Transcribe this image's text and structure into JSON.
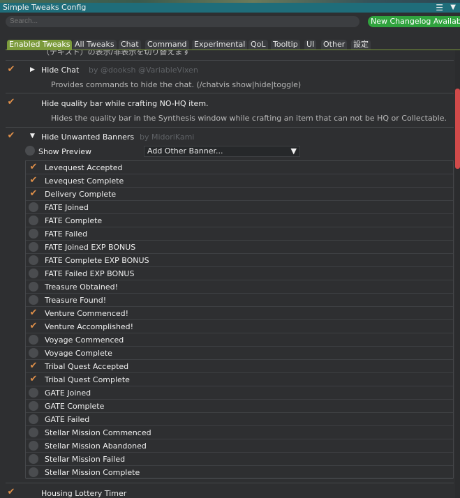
{
  "window": {
    "title": "Simple Tweaks Config",
    "menu_icon": "hamburger-icon",
    "collapse_icon": "triangle-down-icon"
  },
  "search": {
    "placeholder": "Search..."
  },
  "changelog_button": "New Changelog Available",
  "tabs": [
    {
      "label": "Enabled Tweaks",
      "active": true
    },
    {
      "label": "All Tweaks"
    },
    {
      "label": "Chat"
    },
    {
      "label": "Command"
    },
    {
      "label": "Experimental"
    },
    {
      "label": "QoL"
    },
    {
      "label": "Tooltip"
    },
    {
      "label": "UI"
    },
    {
      "label": "Other"
    },
    {
      "label": "設定"
    }
  ],
  "cut_off_text": "（テキスト）の表示/非表示を切り替えます",
  "tweaks": [
    {
      "name": "Hide Chat",
      "author": "by @dooksh @VariableVixen",
      "desc": "Provides commands to hide the chat. (/chatvis show|hide|toggle)",
      "enabled": true
    },
    {
      "name": "Hide quality bar while crafting NO-HQ item.",
      "author": "",
      "desc": "Hides the quality bar in the Synthesis window while crafting an item that can not be HQ or Collectable.",
      "enabled": true
    },
    {
      "name": "Hide Unwanted Banners",
      "author": "by MidoriKami",
      "desc": "",
      "enabled": true
    },
    {
      "name": "Housing Lottery Timer",
      "author": "",
      "desc": "",
      "enabled": true
    }
  ],
  "banners": {
    "show_preview_label": "Show Preview",
    "add_other_label": "Add Other Banner...",
    "items": [
      {
        "label": "Levequest Accepted",
        "checked": true
      },
      {
        "label": "Levequest Complete",
        "checked": true
      },
      {
        "label": "Delivery Complete",
        "checked": true
      },
      {
        "label": "FATE Joined",
        "checked": false
      },
      {
        "label": "FATE Complete",
        "checked": false
      },
      {
        "label": "FATE Failed",
        "checked": false
      },
      {
        "label": "FATE Joined EXP BONUS",
        "checked": false
      },
      {
        "label": "FATE Complete EXP BONUS",
        "checked": false
      },
      {
        "label": "FATE Failed EXP BONUS",
        "checked": false
      },
      {
        "label": "Treasure Obtained!",
        "checked": false
      },
      {
        "label": "Treasure Found!",
        "checked": false
      },
      {
        "label": "Venture Commenced!",
        "checked": true
      },
      {
        "label": "Venture Accomplished!",
        "checked": true
      },
      {
        "label": "Voyage Commenced",
        "checked": false
      },
      {
        "label": "Voyage Complete",
        "checked": false
      },
      {
        "label": "Tribal Quest Accepted",
        "checked": true
      },
      {
        "label": "Tribal Quest Complete",
        "checked": true
      },
      {
        "label": "GATE Joined",
        "checked": false
      },
      {
        "label": "GATE Complete",
        "checked": false
      },
      {
        "label": "GATE Failed",
        "checked": false
      },
      {
        "label": "Stellar Mission Commenced",
        "checked": false
      },
      {
        "label": "Stellar Mission Abandoned",
        "checked": false
      },
      {
        "label": "Stellar Mission Failed",
        "checked": false
      },
      {
        "label": "Stellar Mission Complete",
        "checked": false
      }
    ]
  },
  "colors": {
    "titlebar": "#1f6d7a",
    "accent_tab": "#7b9a3b",
    "changelog": "#30a33e",
    "checkmark": "#e0904a",
    "scroll_thumb": "#d14a4a"
  }
}
